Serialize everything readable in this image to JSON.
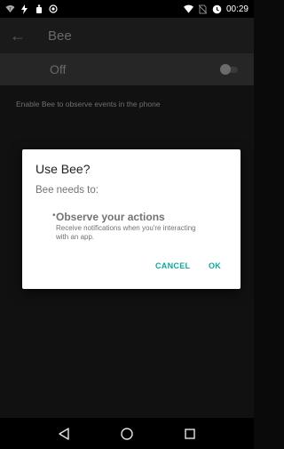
{
  "status_bar": {
    "time": "00:29",
    "left_icons": [
      "wifi-question-icon",
      "flash-icon",
      "notification-icon",
      "record-icon"
    ],
    "right_icons": [
      "wifi-icon",
      "no-sim-icon",
      "alarm-icon"
    ]
  },
  "toolbar": {
    "back_glyph": "←",
    "title": "Bee"
  },
  "switch": {
    "label": "Off",
    "state": false
  },
  "content": {
    "description": "Enable Bee to observe events in the phone"
  },
  "dialog": {
    "title": "Use Bee?",
    "subtitle": "Bee needs to:",
    "bullet": "•",
    "permission_title": "Observe your actions",
    "permission_desc": "Receive notifications when you're interacting with an app.",
    "cancel_label": "CANCEL",
    "ok_label": "OK"
  },
  "nav": {
    "back_glyph": "◁",
    "home_glyph": "○",
    "recents_glyph": "□"
  },
  "colors": {
    "accent": "#11a89a",
    "dim_text": "#6a6a6a"
  }
}
